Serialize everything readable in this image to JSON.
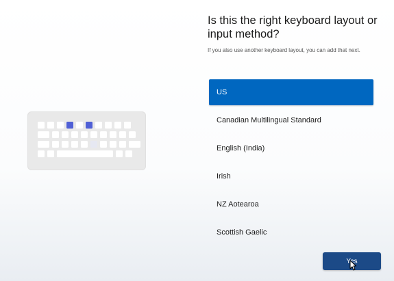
{
  "header": {
    "title": "Is this the right keyboard layout or input method?",
    "subtitle": "If you also use another keyboard layout, you can add that next."
  },
  "layouts": [
    {
      "label": "US",
      "selected": true
    },
    {
      "label": "Canadian Multilingual Standard",
      "selected": false
    },
    {
      "label": "English (India)",
      "selected": false
    },
    {
      "label": "Irish",
      "selected": false
    },
    {
      "label": "NZ Aotearoa",
      "selected": false
    },
    {
      "label": "Scottish Gaelic",
      "selected": false
    }
  ],
  "footer": {
    "yes_label": "Yes"
  },
  "illustration": {
    "icon": "keyboard-icon"
  },
  "colors": {
    "accent": "#0067c0",
    "button": "#1c4a87",
    "key_accent": "#5060d6"
  }
}
